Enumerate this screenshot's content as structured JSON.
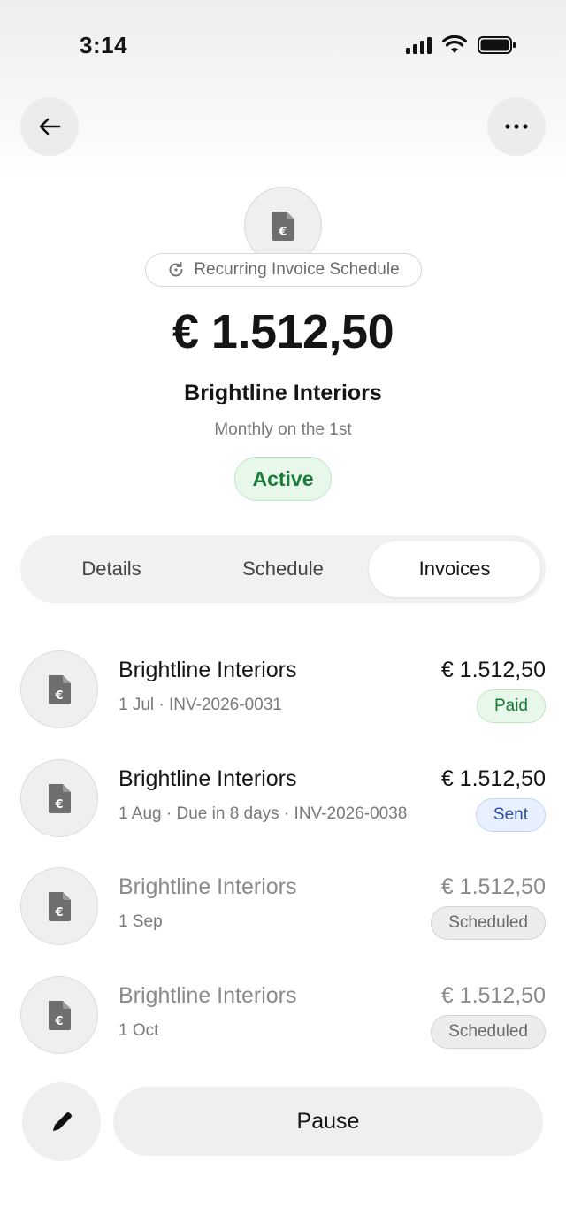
{
  "status_bar": {
    "time": "3:14"
  },
  "header": {
    "back_icon": "arrow-left-icon",
    "more_icon": "ellipsis-icon"
  },
  "hero": {
    "icon": "document-euro-icon",
    "type_label": "Recurring Invoice Schedule",
    "type_icon": "refresh-icon",
    "amount": "€ 1.512,50",
    "client": "Brightline Interiors",
    "frequency": "Monthly on the 1st",
    "status": "Active"
  },
  "tabs": [
    {
      "label": "Details",
      "active": false
    },
    {
      "label": "Schedule",
      "active": false
    },
    {
      "label": "Invoices",
      "active": true
    }
  ],
  "invoices": [
    {
      "client": "Brightline Interiors",
      "meta": "1 Jul · INV-2026-0031",
      "amount": "€ 1.512,50",
      "status": "Paid"
    },
    {
      "client": "Brightline Interiors",
      "meta": "1 Aug · Due in 8 days · INV-2026-0038",
      "amount": "€ 1.512,50",
      "status": "Sent"
    },
    {
      "client": "Brightline Interiors",
      "meta": "1 Sep",
      "amount": "€ 1.512,50",
      "status": "Scheduled"
    },
    {
      "client": "Brightline Interiors",
      "meta": "1 Oct",
      "amount": "€ 1.512,50",
      "status": "Scheduled"
    }
  ],
  "actions": {
    "edit_icon": "pencil-icon",
    "pause_label": "Pause"
  },
  "colors": {
    "active_green": "#1a7d37",
    "sent_blue": "#2c4ea6",
    "scheduled_gray": "#6a6a6a"
  }
}
